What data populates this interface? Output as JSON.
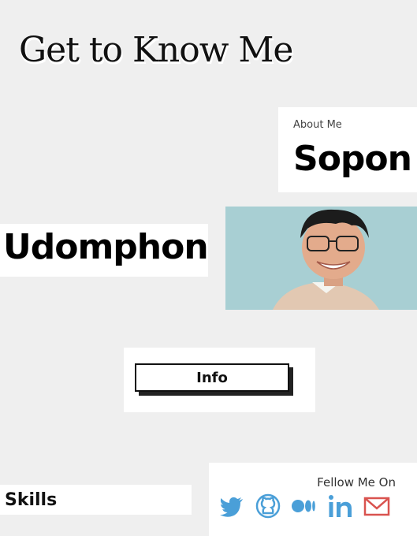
{
  "header": {
    "title": "Get to Know Me"
  },
  "about": {
    "label": "About Me",
    "first_name": "Sopon",
    "last_name": "Udomphon"
  },
  "actions": {
    "info_label": "Info"
  },
  "skills": {
    "heading": "Skills"
  },
  "social": {
    "label": "Fellow Me On",
    "links": [
      "twitter-icon",
      "github-icon",
      "medium-icon",
      "linkedin-icon",
      "gmail-icon"
    ]
  },
  "colors": {
    "background": "#efefef",
    "icon_blue": "#4a9fd8",
    "mail_red": "#d9534f"
  }
}
